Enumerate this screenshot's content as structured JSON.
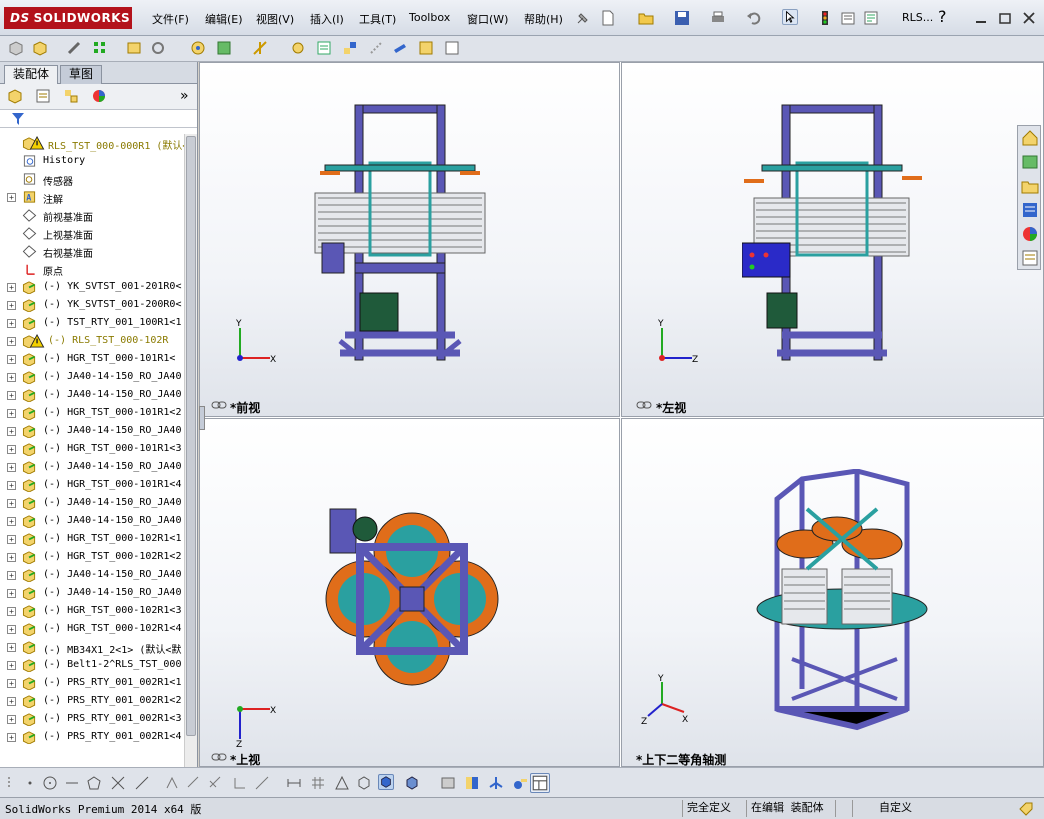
{
  "app": {
    "logo_ds": "DS",
    "logo_text": "SOLIDWORKS",
    "doc_short": "RLS...",
    "help": "?"
  },
  "menu": [
    "文件(F)",
    "编辑(E)",
    "视图(V)",
    "插入(I)",
    "工具(T)",
    "Toolbox",
    "窗口(W)",
    "帮助(H)"
  ],
  "sidebar": {
    "tabs": [
      "装配体",
      "草图"
    ],
    "more": "»",
    "tree": [
      {
        "label": "RLS_TST_000-000R1  (默认<",
        "icon": "assembly-warning",
        "exp": "",
        "color": "#8a7a00"
      },
      {
        "label": "History",
        "icon": "history",
        "exp": ""
      },
      {
        "label": "传感器",
        "icon": "sensor",
        "exp": ""
      },
      {
        "label": "注解",
        "icon": "annotation",
        "exp": "+"
      },
      {
        "label": "前视基准面",
        "icon": "plane",
        "exp": ""
      },
      {
        "label": "上视基准面",
        "icon": "plane",
        "exp": ""
      },
      {
        "label": "右视基准面",
        "icon": "plane",
        "exp": ""
      },
      {
        "label": "原点",
        "icon": "origin",
        "exp": ""
      },
      {
        "label": "(-) YK_SVTST_001-201R0<",
        "icon": "part",
        "exp": "+"
      },
      {
        "label": "(-) YK_SVTST_001-200R0<",
        "icon": "part",
        "exp": "+"
      },
      {
        "label": "(-) TST_RTY_001_100R1<1",
        "icon": "part",
        "exp": "+"
      },
      {
        "label": "(-) RLS_TST_000-102R",
        "icon": "part-warning",
        "exp": "+",
        "color": "#8a7a00"
      },
      {
        "label": "(-) HGR_TST_000-101R1<",
        "icon": "part",
        "exp": "+"
      },
      {
        "label": "(-) JA40-14-150_RO_JA40",
        "icon": "part",
        "exp": "+"
      },
      {
        "label": "(-) JA40-14-150_RO_JA40",
        "icon": "part",
        "exp": "+"
      },
      {
        "label": "(-) HGR_TST_000-101R1<2",
        "icon": "part",
        "exp": "+"
      },
      {
        "label": "(-) JA40-14-150_RO_JA40",
        "icon": "part",
        "exp": "+"
      },
      {
        "label": "(-) HGR_TST_000-101R1<3",
        "icon": "part",
        "exp": "+"
      },
      {
        "label": "(-) JA40-14-150_RO_JA40",
        "icon": "part",
        "exp": "+"
      },
      {
        "label": "(-) HGR_TST_000-101R1<4",
        "icon": "part",
        "exp": "+"
      },
      {
        "label": "(-) JA40-14-150_RO_JA40",
        "icon": "part",
        "exp": "+"
      },
      {
        "label": "(-) JA40-14-150_RO_JA40",
        "icon": "part",
        "exp": "+"
      },
      {
        "label": "(-) HGR_TST_000-102R1<1",
        "icon": "part",
        "exp": "+"
      },
      {
        "label": "(-) HGR_TST_000-102R1<2",
        "icon": "part",
        "exp": "+"
      },
      {
        "label": "(-) JA40-14-150_RO_JA40",
        "icon": "part",
        "exp": "+"
      },
      {
        "label": "(-) JA40-14-150_RO_JA40",
        "icon": "part",
        "exp": "+"
      },
      {
        "label": "(-) HGR_TST_000-102R1<3",
        "icon": "part",
        "exp": "+"
      },
      {
        "label": "(-) HGR_TST_000-102R1<4",
        "icon": "part",
        "exp": "+"
      },
      {
        "label": "(-) MB34X1_2<1> (默认<默",
        "icon": "part",
        "exp": "+"
      },
      {
        "label": "(-) Belt1-2^RLS_TST_000",
        "icon": "part",
        "exp": "+"
      },
      {
        "label": "(-) PRS_RTY_001_002R1<1",
        "icon": "part",
        "exp": "+"
      },
      {
        "label": "(-) PRS_RTY_001_002R1<2",
        "icon": "part",
        "exp": "+"
      },
      {
        "label": "(-) PRS_RTY_001_002R1<3",
        "icon": "part",
        "exp": "+"
      },
      {
        "label": "(-) PRS_RTY_001_002R1<4",
        "icon": "part",
        "exp": "+"
      }
    ]
  },
  "views": {
    "front": "*前视",
    "left": "*左视",
    "top": "*上视",
    "iso": "*上下二等角轴测"
  },
  "axes": {
    "x": "X",
    "y": "Y",
    "z": "Z"
  },
  "status": {
    "app": "SolidWorks Premium 2014 x64 版",
    "underdefined": "完全定义",
    "editing": "在编辑 装配体",
    "custom": "自定义"
  },
  "colors": {
    "frame": "#5a57b5",
    "teal": "#2aa0a0",
    "orange": "#e06d1a",
    "accent": "#b3121b"
  }
}
